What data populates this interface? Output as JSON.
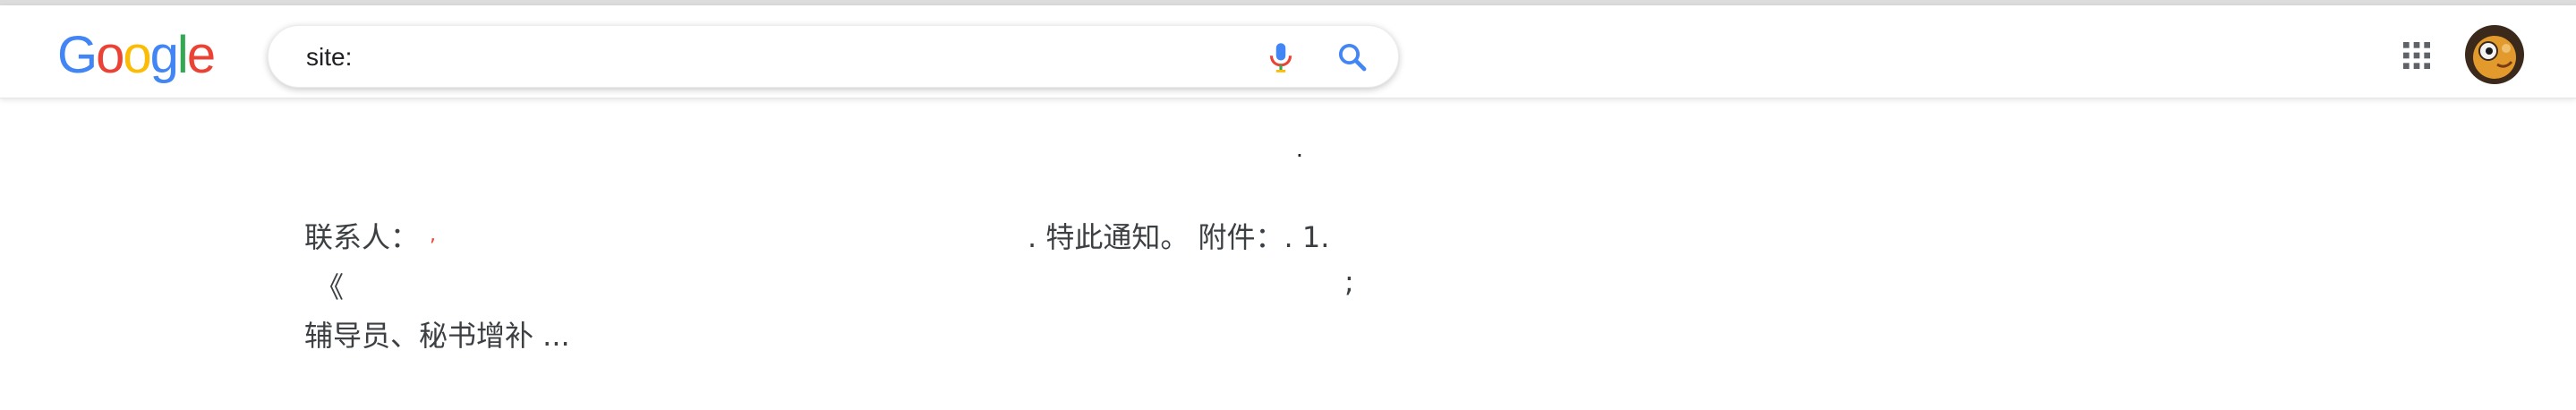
{
  "header": {
    "logo_letters": [
      "G",
      "o",
      "o",
      "g",
      "l",
      "e"
    ],
    "logo_colors": [
      "#4285F4",
      "#EA4335",
      "#FBBC05",
      "#4285F4",
      "#34A853",
      "#EA4335"
    ],
    "search": {
      "value": "site:",
      "mic_icon": "mic-icon",
      "search_icon": "search-icon"
    },
    "apps_icon": "apps-grid-icon",
    "avatar_icon": "avatar"
  },
  "result": {
    "dot": ".",
    "line1_left": "联系人：",
    "line1_mark": ",",
    "line1_right": ". 特此通知。 附件：. 1.",
    "line2_left": "《",
    "line2_right": ";",
    "line3": "辅导员、秘书增补 ..."
  }
}
